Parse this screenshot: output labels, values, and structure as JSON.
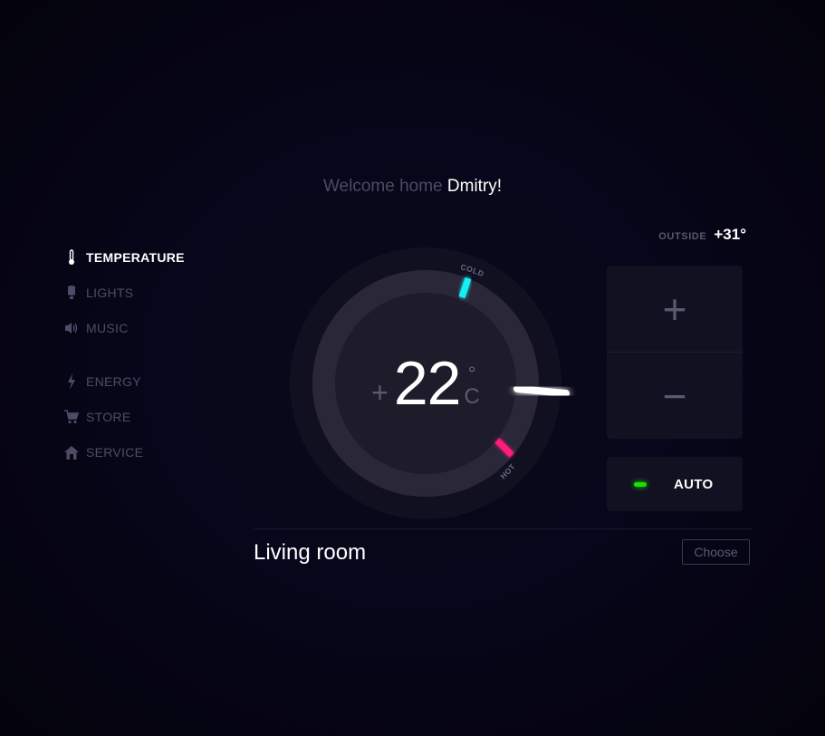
{
  "nav": {
    "items": [
      {
        "label": "TEMPERATURE",
        "icon": "thermometer-icon",
        "active": true
      },
      {
        "label": "LIGHTS",
        "icon": "bulb-icon",
        "active": false
      },
      {
        "label": "MUSIC",
        "icon": "speaker-icon",
        "active": false
      },
      {
        "label": "ENERGY",
        "icon": "bolt-icon",
        "active": false
      },
      {
        "label": "STORE",
        "icon": "cart-icon",
        "active": false
      },
      {
        "label": "SERVICE",
        "icon": "house-icon",
        "active": false
      }
    ]
  },
  "welcome": {
    "prefix": "Welcome home",
    "name": "Dmitry!"
  },
  "outside": {
    "label": "OUTSIDE",
    "value": "+31°"
  },
  "dial": {
    "sign": "+",
    "temperature": "22",
    "degree": "°",
    "unit": "C",
    "cold_label": "COLD",
    "hot_label": "HOT"
  },
  "controls": {
    "increase": "+",
    "decrease": "−",
    "mode_label": "AUTO",
    "mode_on": true
  },
  "room": {
    "name": "Living room",
    "choose_label": "Choose"
  },
  "colors": {
    "cold": "#19f0f5",
    "hot": "#ff1f7a",
    "led": "#19e000",
    "background": "#05040f"
  }
}
